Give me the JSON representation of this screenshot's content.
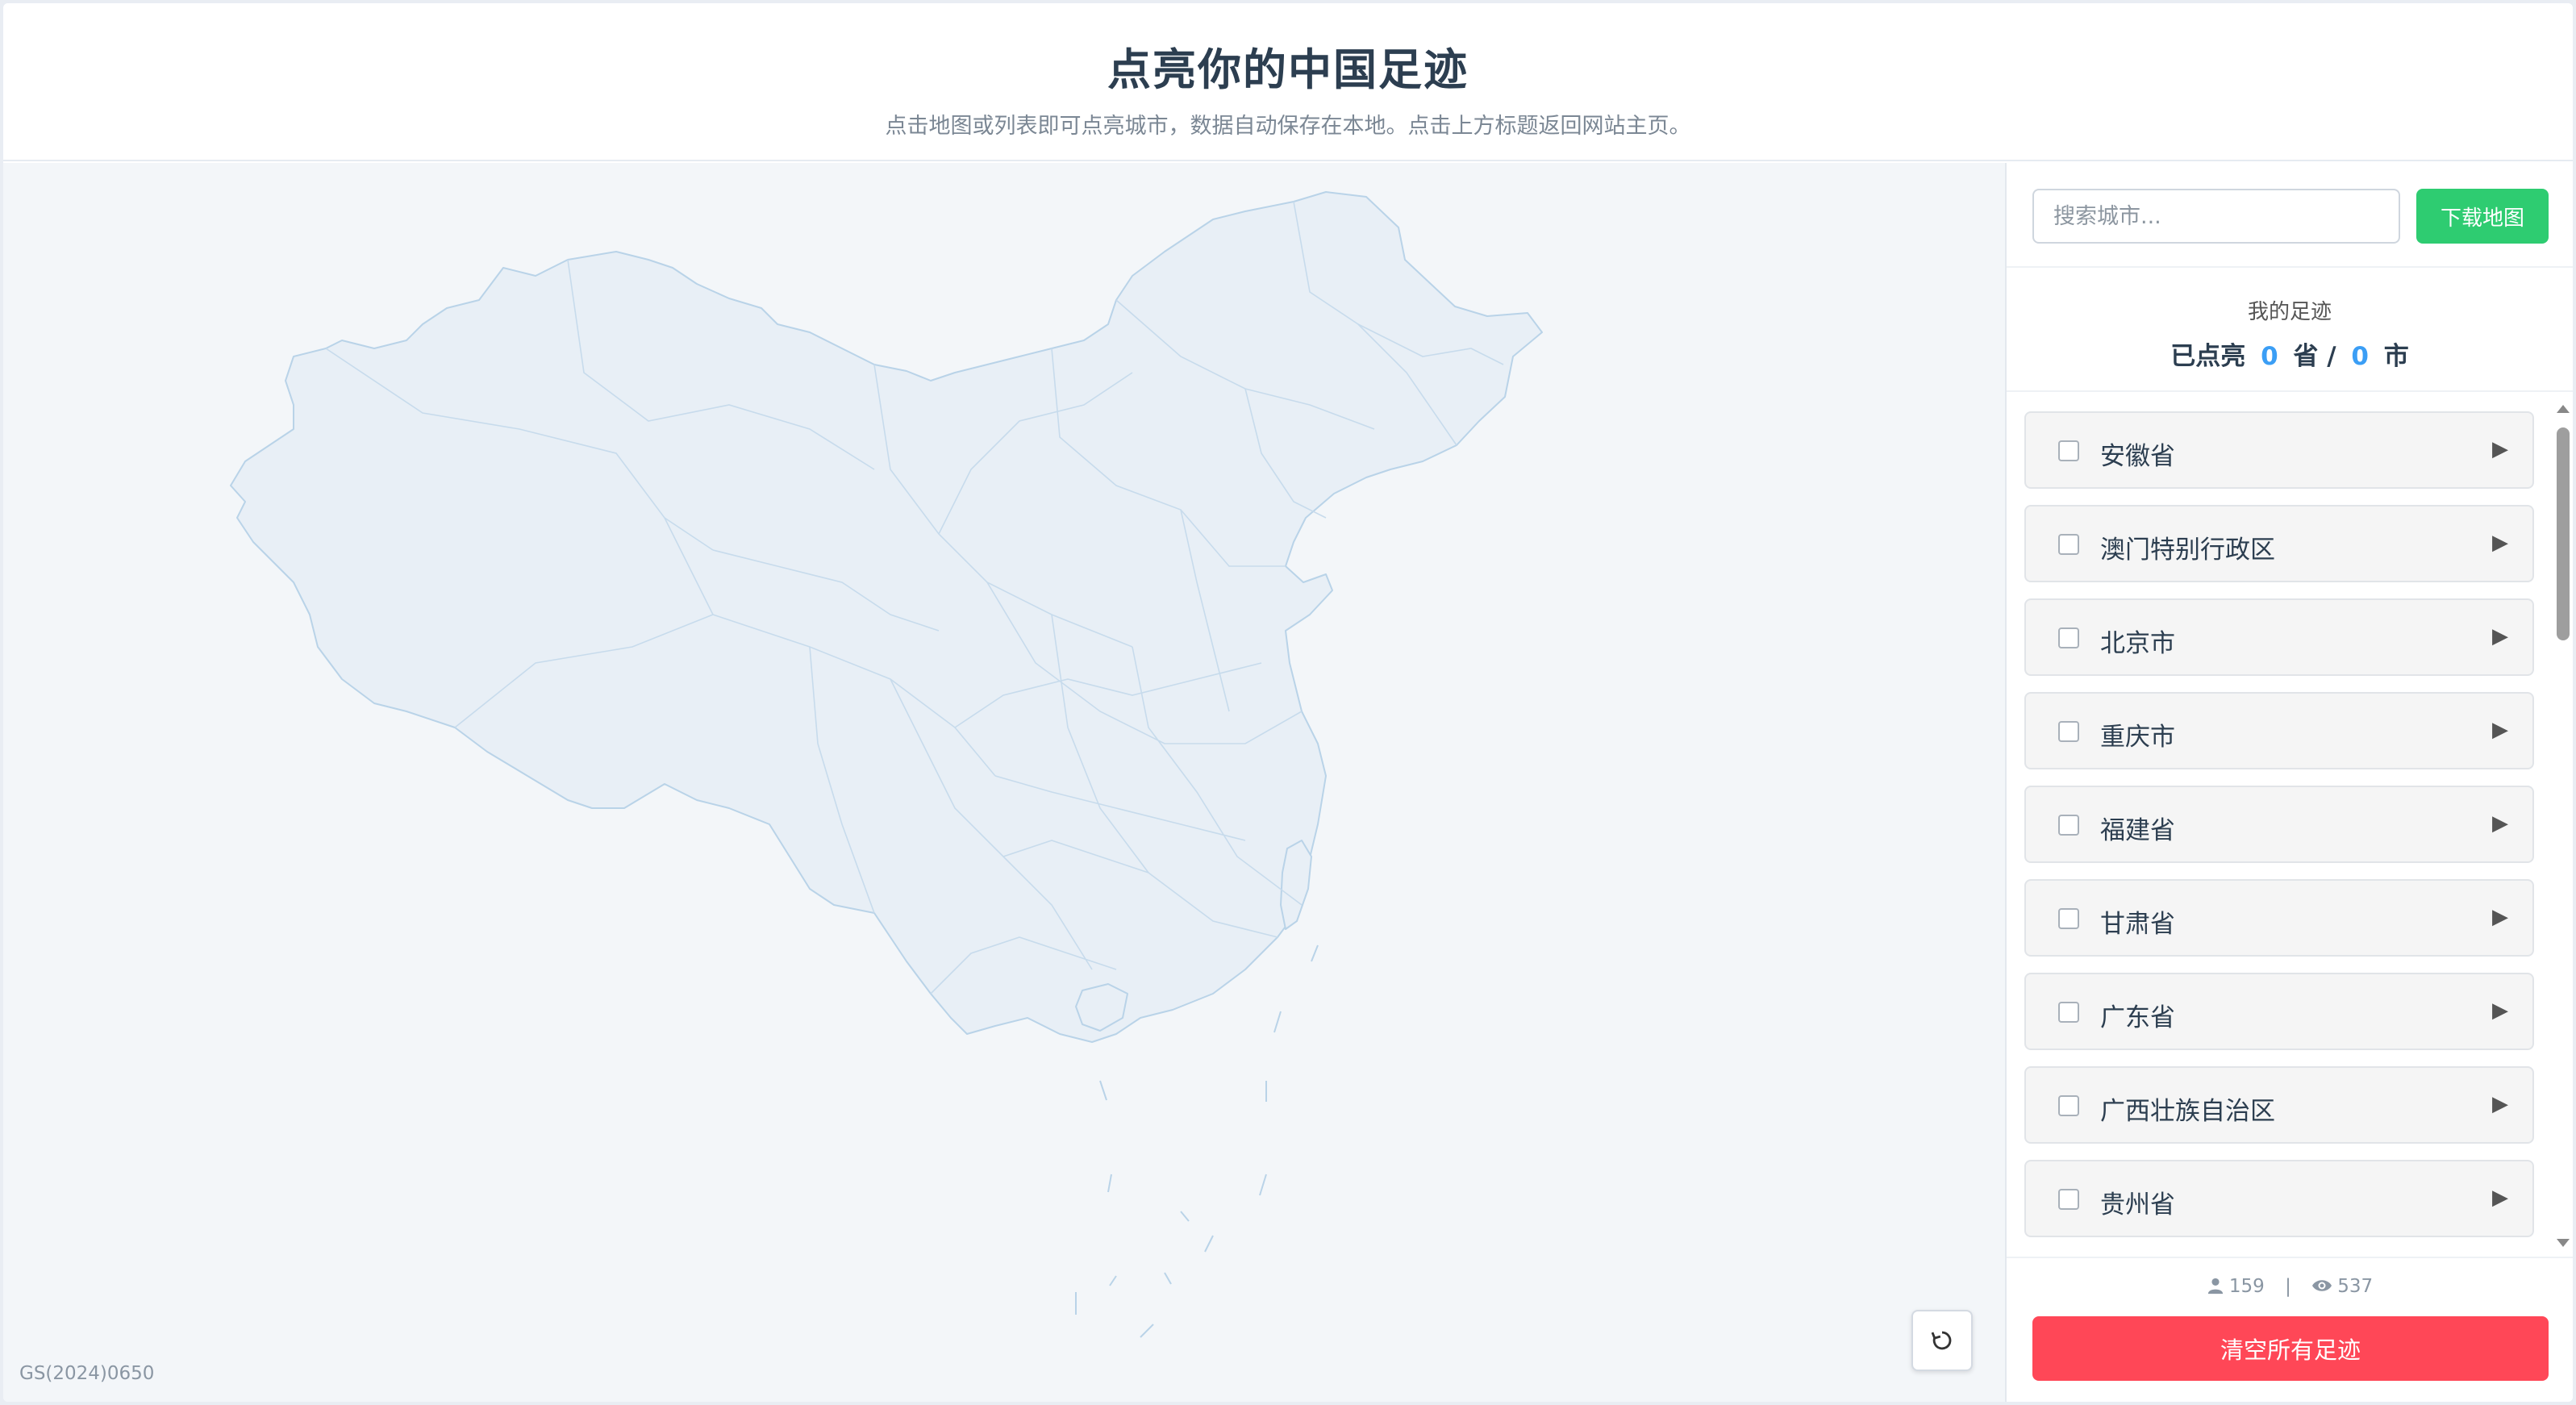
{
  "header": {
    "title": "点亮你的中国足迹",
    "subtitle": "点击地图或列表即可点亮城市，数据自动保存在本地。点击上方标题返回网站主页。"
  },
  "map": {
    "approval_number": "GS(2024)0650",
    "fill_color": "#e8eff6",
    "border_color": "#b9d3e8"
  },
  "search": {
    "placeholder": "搜索城市..."
  },
  "toolbar": {
    "download_label": "下载地图",
    "reset_icon": "refresh-icon"
  },
  "stats": {
    "heading": "我的足迹",
    "prefix": "已点亮",
    "province_count": "0",
    "province_unit": "省 /",
    "city_count": "0",
    "city_unit": "市"
  },
  "provinces": [
    {
      "name": "安徽省"
    },
    {
      "name": "澳门特别行政区"
    },
    {
      "name": "北京市"
    },
    {
      "name": "重庆市"
    },
    {
      "name": "福建省"
    },
    {
      "name": "甘肃省"
    },
    {
      "name": "广东省"
    },
    {
      "name": "广西壮族自治区"
    },
    {
      "name": "贵州省"
    }
  ],
  "footer": {
    "visitors": "159",
    "separator": "|",
    "views": "537",
    "clear_label": "清空所有足迹"
  },
  "colors": {
    "accent_green": "#2ecc71",
    "accent_red": "#ff4757",
    "accent_blue": "#3b9ef5"
  }
}
